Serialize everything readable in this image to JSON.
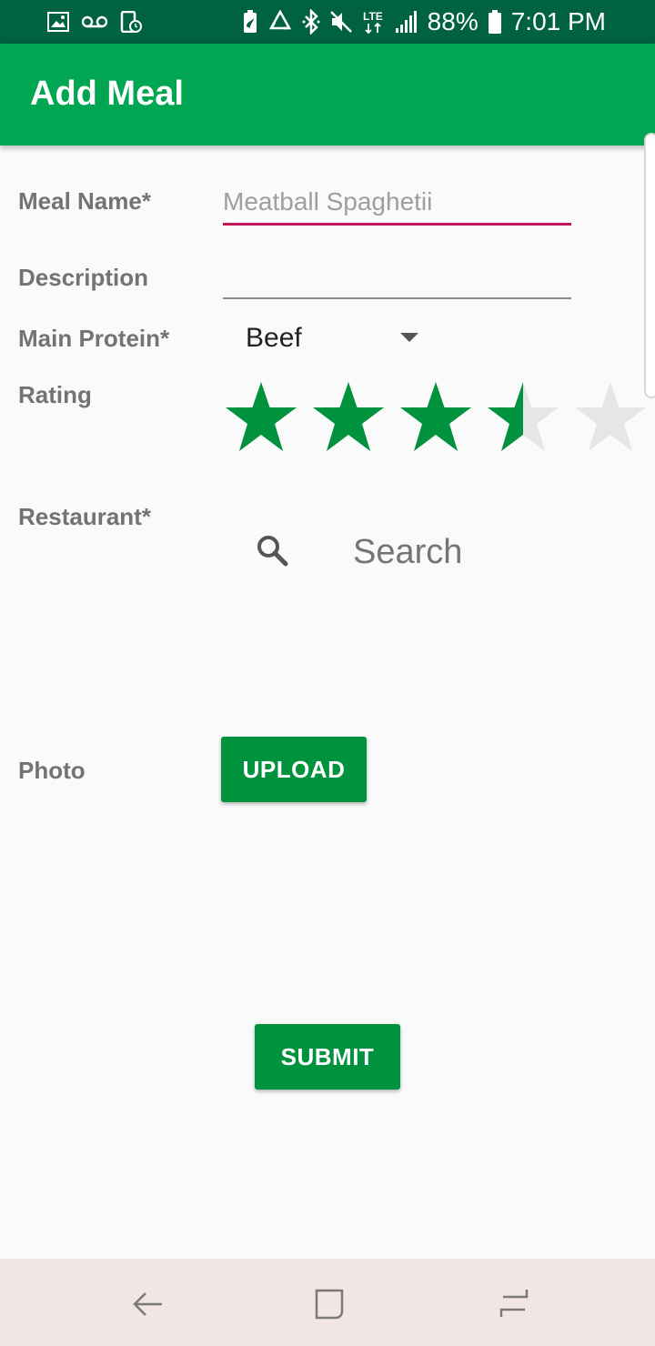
{
  "status_bar": {
    "battery_percent": "88%",
    "time": "7:01 PM",
    "network": "LTE",
    "icons": [
      "image-icon",
      "voicemail-icon",
      "screenshot-icon",
      "battery-saver-icon",
      "recycle-icon",
      "bluetooth-icon",
      "mute-icon",
      "lte-icon",
      "signal-icon",
      "battery-icon"
    ]
  },
  "app_bar": {
    "title": "Add Meal"
  },
  "form": {
    "meal_name": {
      "label": "Meal Name*",
      "value": "Meatball Spaghetii"
    },
    "description": {
      "label": "Description",
      "value": ""
    },
    "main_protein": {
      "label": "Main Protein*",
      "selected": "Beef"
    },
    "rating": {
      "label": "Rating",
      "value": 3.5,
      "max": 5
    },
    "restaurant": {
      "label": "Restaurant*",
      "search_placeholder": "Search"
    },
    "photo": {
      "label": "Photo",
      "upload_label": "UPLOAD"
    },
    "submit_label": "SUBMIT"
  },
  "colors": {
    "status_bar": "#00623f",
    "app_bar": "#00a651",
    "accent_green": "#00923d",
    "active_underline": "#c2185b",
    "star_empty": "#e6e6e6"
  },
  "nav_bar": {
    "buttons": [
      "back-icon",
      "home-icon",
      "recent-apps-icon"
    ]
  }
}
